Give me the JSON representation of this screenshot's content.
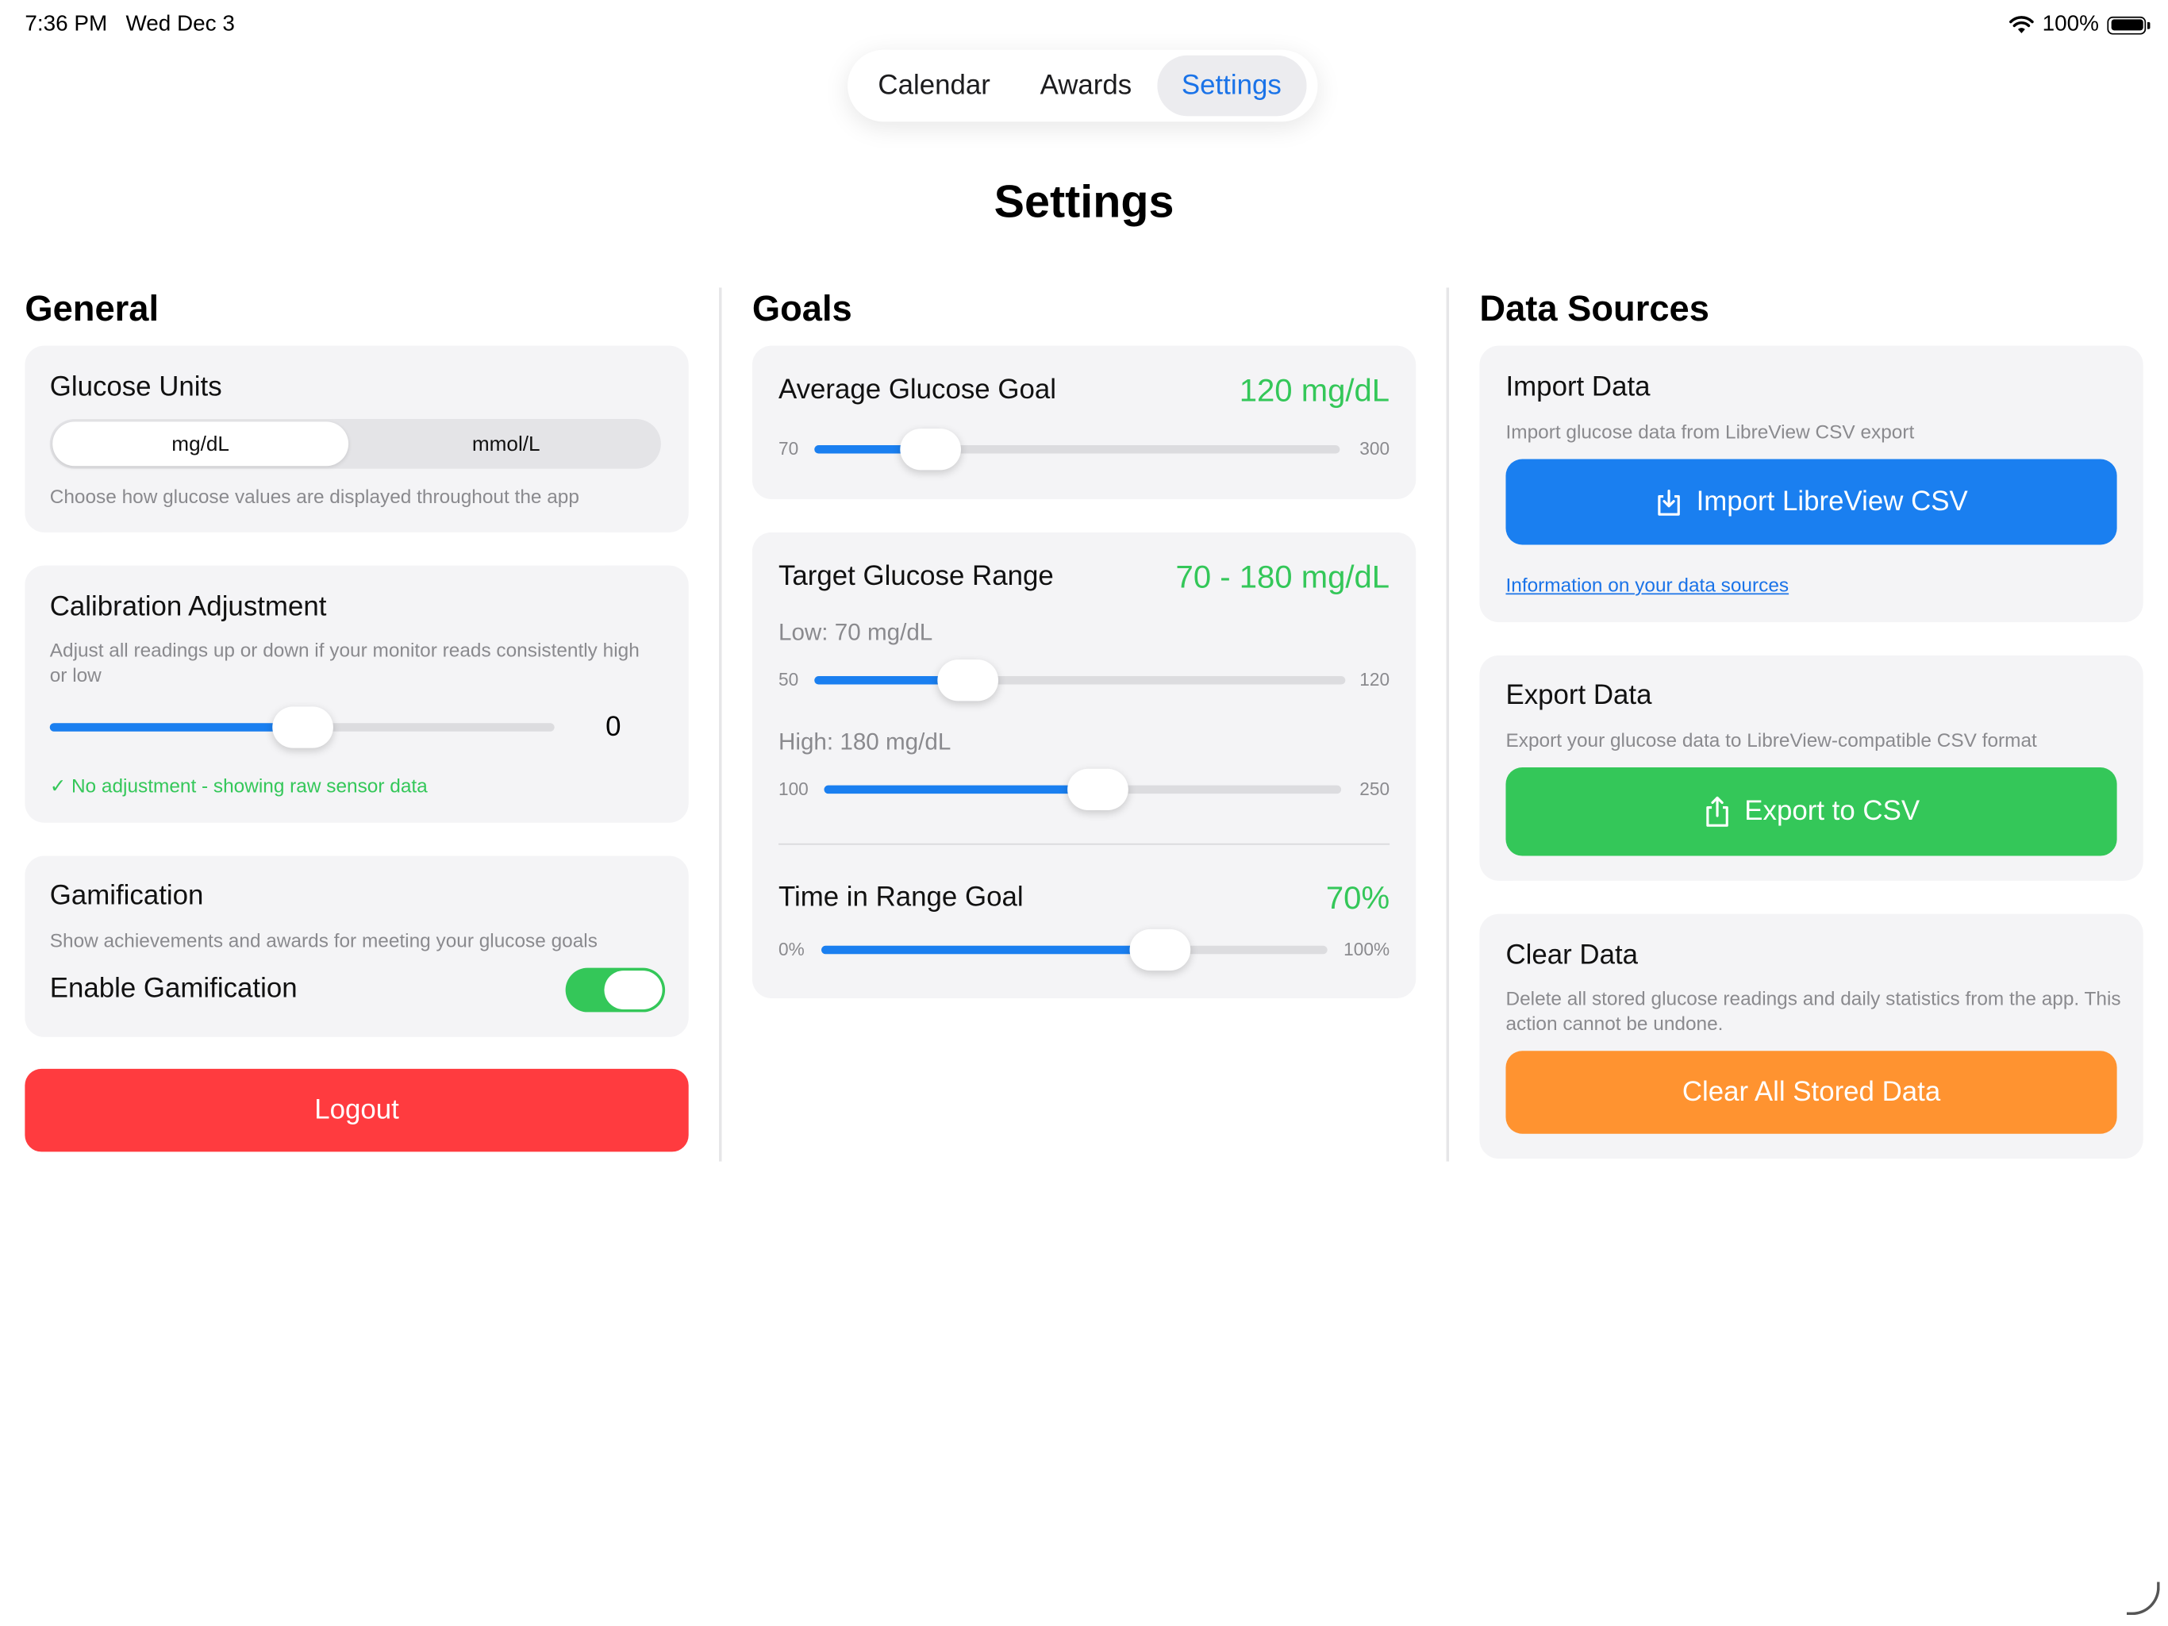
{
  "status_bar": {
    "time": "7:36 PM",
    "date": "Wed Dec 3",
    "battery": "100%",
    "wifi_icon": "wifi-icon",
    "battery_icon": "battery-icon"
  },
  "tabs": [
    {
      "label": "Calendar",
      "active": false
    },
    {
      "label": "Awards",
      "active": false
    },
    {
      "label": "Settings",
      "active": true
    }
  ],
  "page_title": "Settings",
  "general": {
    "title": "General",
    "glucose_units": {
      "title": "Glucose Units",
      "options": [
        "mg/dL",
        "mmol/L"
      ],
      "selected": "mg/dL",
      "description": "Choose how glucose values are displayed throughout the app"
    },
    "calibration": {
      "title": "Calibration Adjustment",
      "description": "Adjust all readings up or down if your monitor reads consistently high or low",
      "value": "0",
      "slider_fraction": 0.5,
      "status": "✓ No adjustment - showing raw sensor data"
    },
    "gamification": {
      "title": "Gamification",
      "description": "Show achievements and awards for meeting your glucose goals",
      "toggle_label": "Enable Gamification",
      "enabled": true
    },
    "logout_label": "Logout"
  },
  "goals": {
    "title": "Goals",
    "average": {
      "title": "Average Glucose Goal",
      "value": "120 mg/dL",
      "min": "70",
      "max": "300",
      "fraction": 0.22
    },
    "target_range": {
      "title": "Target Glucose Range",
      "value": "70 - 180 mg/dL",
      "low_label": "Low: 70 mg/dL",
      "low_min": "50",
      "low_max": "120",
      "low_fraction": 0.29,
      "high_label": "High: 180 mg/dL",
      "high_min": "100",
      "high_max": "250",
      "high_fraction": 0.53
    },
    "time_in_range": {
      "title": "Time in Range Goal",
      "value": "70%",
      "min": "0%",
      "max": "100%",
      "fraction": 0.67
    }
  },
  "data_sources": {
    "title": "Data Sources",
    "import": {
      "title": "Import Data",
      "description": "Import glucose data from LibreView CSV export",
      "button": "Import LibreView CSV",
      "link": "Information on your data sources"
    },
    "export": {
      "title": "Export Data",
      "description": "Export your glucose data to LibreView-compatible CSV format",
      "button": "Export to CSV"
    },
    "clear": {
      "title": "Clear Data",
      "description": "Delete all stored glucose readings and daily statistics from the app. This action cannot be undone.",
      "button": "Clear All Stored Data"
    }
  },
  "colors": {
    "accent": "#1a7ff0",
    "success": "#34c759",
    "danger": "#ff3b3f",
    "warning": "#ff9330"
  }
}
